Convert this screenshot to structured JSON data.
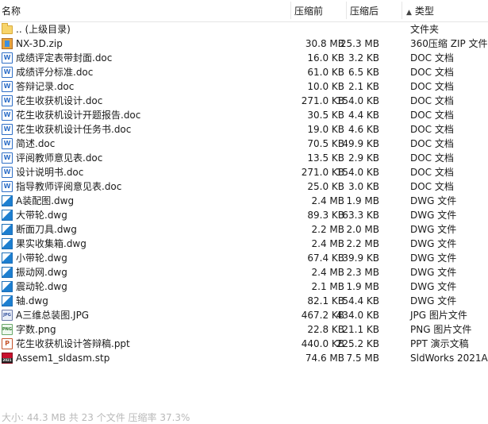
{
  "header": {
    "name": "名称",
    "compressed": "压缩前",
    "original": "压缩后",
    "type": "类型",
    "sort_indicator": "▲"
  },
  "files": [
    {
      "name": ".. (上级目录)",
      "compressed": "",
      "original": "",
      "type": "文件夹",
      "icon": "folder-icon"
    },
    {
      "name": "NX-3D.zip",
      "compressed": "30.8 MB",
      "original": "25.3 MB",
      "type": "360压缩 ZIP 文件",
      "icon": "zip-icon"
    },
    {
      "name": "成绩评定表带封面.doc",
      "compressed": "16.0 KB",
      "original": "3.2 KB",
      "type": "DOC 文档",
      "icon": "doc-icon"
    },
    {
      "name": "成绩评分标准.doc",
      "compressed": "61.0 KB",
      "original": "6.5 KB",
      "type": "DOC 文档",
      "icon": "doc-icon"
    },
    {
      "name": "答辩记录.doc",
      "compressed": "10.0 KB",
      "original": "2.1 KB",
      "type": "DOC 文档",
      "icon": "doc-icon"
    },
    {
      "name": "花生收获机设计.doc",
      "compressed": "271.0 KB",
      "original": "154.0 KB",
      "type": "DOC 文档",
      "icon": "doc-icon"
    },
    {
      "name": "花生收获机设计开题报告.doc",
      "compressed": "30.5 KB",
      "original": "4.4 KB",
      "type": "DOC 文档",
      "icon": "doc-icon"
    },
    {
      "name": "花生收获机设计任务书.doc",
      "compressed": "19.0 KB",
      "original": "4.6 KB",
      "type": "DOC 文档",
      "icon": "doc-icon"
    },
    {
      "name": "简述.doc",
      "compressed": "70.5 KB",
      "original": "49.9 KB",
      "type": "DOC 文档",
      "icon": "doc-icon"
    },
    {
      "name": "评阅教师意见表.doc",
      "compressed": "13.5 KB",
      "original": "2.9 KB",
      "type": "DOC 文档",
      "icon": "doc-icon"
    },
    {
      "name": "设计说明书.doc",
      "compressed": "271.0 KB",
      "original": "154.0 KB",
      "type": "DOC 文档",
      "icon": "doc-icon"
    },
    {
      "name": "指导教师评阅意见表.doc",
      "compressed": "25.0 KB",
      "original": "3.0 KB",
      "type": "DOC 文档",
      "icon": "doc-icon"
    },
    {
      "name": "A装配图.dwg",
      "compressed": "2.4 MB",
      "original": "1.9 MB",
      "type": "DWG 文件",
      "icon": "dwg-icon"
    },
    {
      "name": "大带轮.dwg",
      "compressed": "89.3 KB",
      "original": "63.3 KB",
      "type": "DWG 文件",
      "icon": "dwg-icon"
    },
    {
      "name": "断面刀具.dwg",
      "compressed": "2.2 MB",
      "original": "2.0 MB",
      "type": "DWG 文件",
      "icon": "dwg-icon"
    },
    {
      "name": "果实收集箱.dwg",
      "compressed": "2.4 MB",
      "original": "2.2 MB",
      "type": "DWG 文件",
      "icon": "dwg-icon"
    },
    {
      "name": "小带轮.dwg",
      "compressed": "67.4 KB",
      "original": "39.9 KB",
      "type": "DWG 文件",
      "icon": "dwg-icon"
    },
    {
      "name": "振动网.dwg",
      "compressed": "2.4 MB",
      "original": "2.3 MB",
      "type": "DWG 文件",
      "icon": "dwg-icon"
    },
    {
      "name": "震动轮.dwg",
      "compressed": "2.1 MB",
      "original": "1.9 MB",
      "type": "DWG 文件",
      "icon": "dwg-icon"
    },
    {
      "name": "轴.dwg",
      "compressed": "82.1 KB",
      "original": "54.4 KB",
      "type": "DWG 文件",
      "icon": "dwg-icon"
    },
    {
      "name": "A三维总装图.JPG",
      "compressed": "467.2 KB",
      "original": "434.0 KB",
      "type": "JPG 图片文件",
      "icon": "jpg-icon"
    },
    {
      "name": "字数.png",
      "compressed": "22.8 KB",
      "original": "21.1 KB",
      "type": "PNG 图片文件",
      "icon": "png-icon"
    },
    {
      "name": "花生收获机设计答辩稿.ppt",
      "compressed": "440.0 KB",
      "original": "225.2 KB",
      "type": "PPT 演示文稿",
      "icon": "ppt-icon"
    },
    {
      "name": "Assem1_sldasm.stp",
      "compressed": "74.6 MB",
      "original": "7.5 MB",
      "type": "SldWorks 2021A...",
      "icon": "stp-icon"
    }
  ],
  "status": "大小: 44.3 MB 共 23 个文件 压缩率 37.3%"
}
